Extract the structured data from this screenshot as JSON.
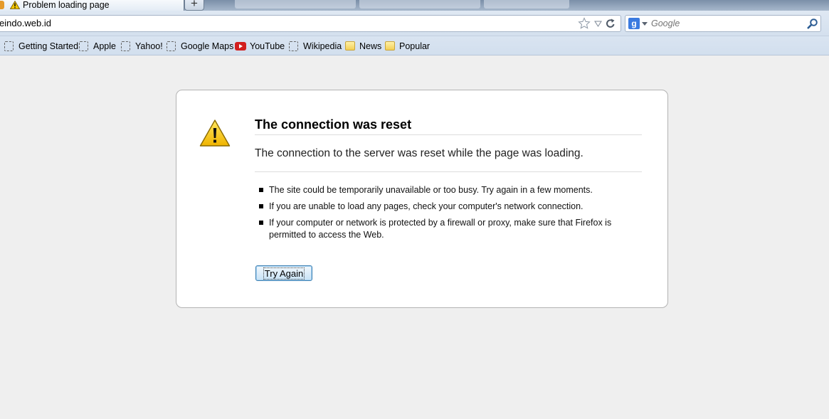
{
  "tab": {
    "title": "Problem loading page",
    "new_tab_symbol": "+"
  },
  "navbar": {
    "url": "eindo.web.id",
    "search_placeholder": "Google",
    "search_engine_letter": "g"
  },
  "bookmarks": [
    {
      "label": "Getting Started",
      "icon": "blank-page-icon"
    },
    {
      "label": "Apple",
      "icon": "blank-page-icon"
    },
    {
      "label": "Yahoo!",
      "icon": "blank-page-icon"
    },
    {
      "label": "Google Maps",
      "icon": "blank-page-icon"
    },
    {
      "label": "YouTube",
      "icon": "youtube-icon"
    },
    {
      "label": "Wikipedia",
      "icon": "blank-page-icon"
    },
    {
      "label": "News",
      "icon": "folder-icon"
    },
    {
      "label": "Popular",
      "icon": "folder-icon"
    }
  ],
  "error": {
    "title": "The connection was reset",
    "description": "The connection to the server was reset while the page was loading.",
    "suggestions": [
      "The site could be temporarily unavailable or too busy. Try again in a few moments.",
      "If you are unable to load any pages, check your computer's network connection.",
      "If your computer or network is protected by a firewall or proxy, make sure that Firefox is permitted to access the Web."
    ],
    "button_label": "Try Again"
  },
  "colors": {
    "accent": "#3b7be0",
    "warning_yellow": "#f2c500",
    "youtube_red": "#d21f1f"
  }
}
